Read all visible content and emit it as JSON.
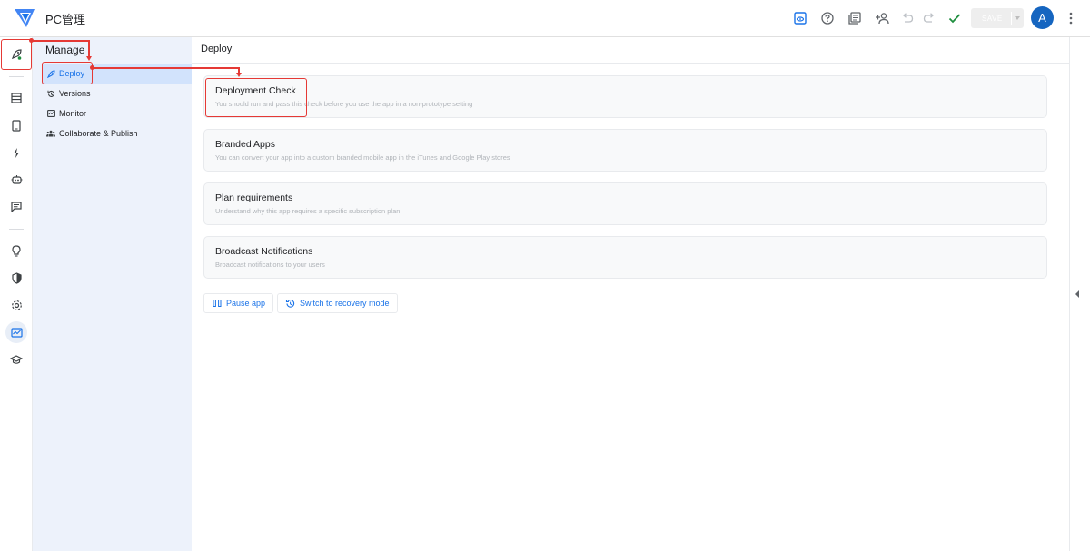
{
  "header": {
    "app_title": "PC管理",
    "save_label": "SAVE",
    "avatar_letter": "A",
    "icons": [
      "preview-icon",
      "help-icon",
      "docs-icon",
      "add-user-icon",
      "undo-icon",
      "redo-icon",
      "checkmark-icon"
    ]
  },
  "rail": {
    "items": [
      "deploy-rocket-icon",
      "data-icon",
      "views-icon",
      "automation-icon",
      "bot-icon",
      "chat-icon",
      "intelligence-icon",
      "security-icon",
      "settings-icon",
      "manage-icon",
      "learn-icon"
    ],
    "active": "manage-icon"
  },
  "manage": {
    "title": "Manage",
    "items": [
      {
        "label": "Deploy",
        "icon": "rocket-icon",
        "active": true
      },
      {
        "label": "Versions",
        "icon": "history-icon",
        "active": false
      },
      {
        "label": "Monitor",
        "icon": "monitor-icon",
        "active": false
      },
      {
        "label": "Collaborate & Publish",
        "icon": "group-icon",
        "active": false
      }
    ]
  },
  "main": {
    "title": "Deploy",
    "cards": [
      {
        "title": "Deployment Check",
        "desc": "You should run and pass this check before you use the app in a non-prototype setting"
      },
      {
        "title": "Branded Apps",
        "desc": "You can convert your app into a custom branded mobile app in the iTunes and Google Play stores"
      },
      {
        "title": "Plan requirements",
        "desc": "Understand why this app requires a specific subscription plan"
      },
      {
        "title": "Broadcast Notifications",
        "desc": "Broadcast notifications to your users"
      }
    ],
    "actions": {
      "pause_label": "Pause app",
      "recovery_label": "Switch to recovery mode"
    }
  },
  "colors": {
    "accent": "#1a73e8",
    "avatar": "#1565c0",
    "annotation": "#e53935",
    "check": "#1e8e3e"
  }
}
